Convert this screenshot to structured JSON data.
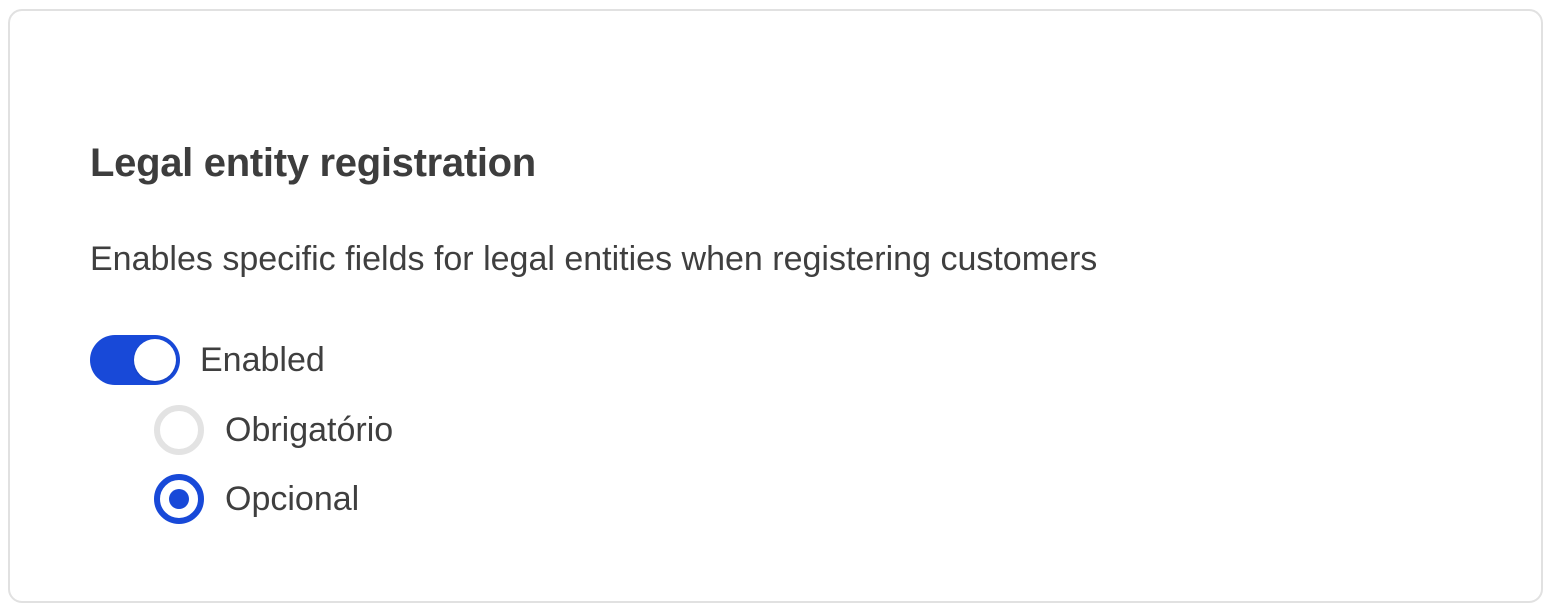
{
  "section": {
    "title": "Legal entity registration",
    "description": "Enables specific fields for legal entities when registering customers"
  },
  "toggle": {
    "label": "Enabled",
    "state": "on",
    "color": "#1849d8"
  },
  "options": [
    {
      "label": "Obrigatório",
      "selected": false
    },
    {
      "label": "Opcional",
      "selected": true
    }
  ],
  "colors": {
    "accent": "#1849d8",
    "text": "#3f3f3f",
    "border": "#e1e1e1",
    "radio_unselected": "#e3e3e3"
  }
}
